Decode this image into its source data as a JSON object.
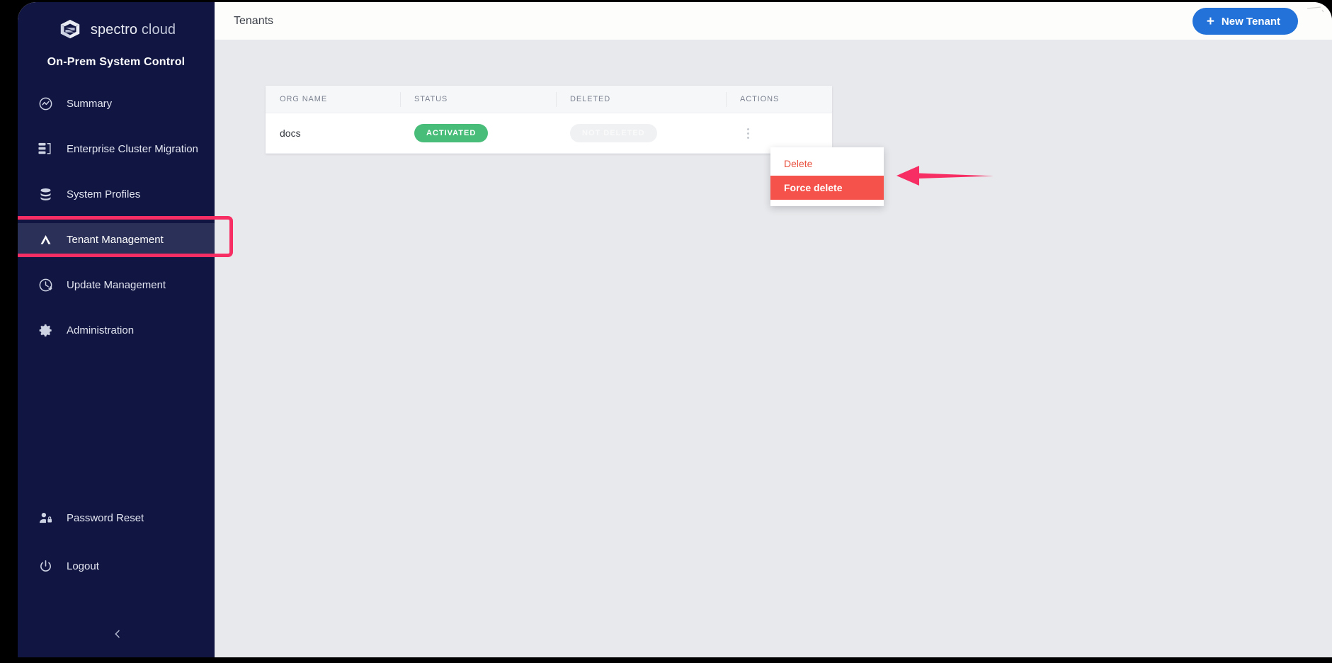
{
  "brand": {
    "logo_icon": "spectro-cloud-logo-icon",
    "name_bold": "spectro",
    "name_light": "cloud",
    "subtitle": "On-Prem System Control"
  },
  "sidebar": {
    "items": [
      {
        "label": "Summary",
        "icon": "activity-circle-icon",
        "active": false
      },
      {
        "label": "Enterprise Cluster Migration",
        "icon": "server-migration-icon",
        "active": false
      },
      {
        "label": "System Profiles",
        "icon": "database-stack-icon",
        "active": false
      },
      {
        "label": "Tenant Management",
        "icon": "tenant-chevron-icon",
        "active": true
      },
      {
        "label": "Update Management",
        "icon": "clock-update-icon",
        "active": false
      },
      {
        "label": "Administration",
        "icon": "gear-icon",
        "active": false
      }
    ],
    "bottom_items": [
      {
        "label": "Password Reset",
        "icon": "user-lock-icon"
      },
      {
        "label": "Logout",
        "icon": "power-icon"
      }
    ],
    "collapse_icon": "chevron-left-icon",
    "highlight_color": "#f72e63"
  },
  "topbar": {
    "title": "Tenants",
    "new_tenant_label": "New Tenant",
    "new_tenant_plus": "+",
    "new_tenant_color": "#2272d9"
  },
  "table": {
    "columns": [
      "ORG NAME",
      "STATUS",
      "DELETED",
      "ACTIONS"
    ],
    "rows": [
      {
        "org_name": "docs",
        "status": "ACTIVATED",
        "status_color": "#48bd79",
        "deleted": "NOT DELETED",
        "deleted_color": "#f0f1f3",
        "actions_icon": "kebab-menu-icon"
      }
    ]
  },
  "dropdown": {
    "items": [
      {
        "label": "Delete",
        "style": "default",
        "color": "#e8523f"
      },
      {
        "label": "Force delete",
        "style": "highlighted",
        "color": "#f4524a"
      }
    ]
  },
  "annotation": {
    "arrow_icon": "left-arrow-annotation-icon",
    "arrow_color": "#f72e63"
  }
}
